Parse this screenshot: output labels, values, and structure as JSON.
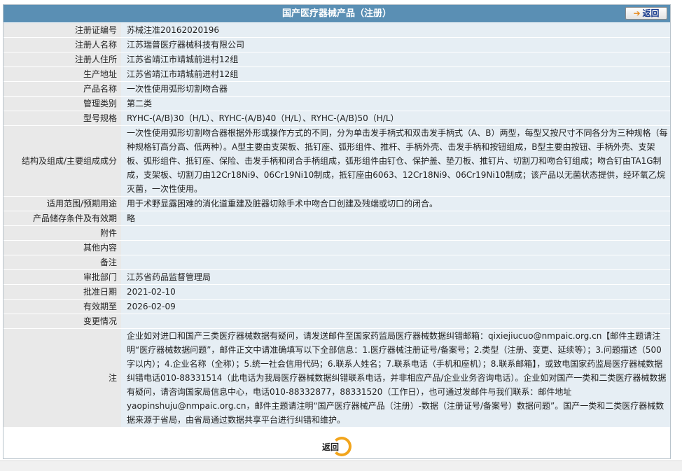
{
  "header": {
    "title": "国产医疗器械产品（注册）",
    "back_label": "返回",
    "back_icon": "arrow-right-icon"
  },
  "rows": [
    {
      "label": "注册证编号",
      "value": "苏械注准20162020196"
    },
    {
      "label": "注册人名称",
      "value": "江苏瑞普医疗器械科技有限公司"
    },
    {
      "label": "注册人住所",
      "value": "江苏省靖江市靖城前进村12组"
    },
    {
      "label": "生产地址",
      "value": "江苏省靖江市靖城前进村12组"
    },
    {
      "label": "产品名称",
      "value": "一次性使用弧形切割吻合器"
    },
    {
      "label": "管理类别",
      "value": "第二类"
    },
    {
      "label": "型号规格",
      "value": "RYHC-(A/B)30（H/L）、RYHC-(A/B)40（H/L）、RYHC-(A/B)50（H/L）"
    },
    {
      "label": "结构及组成/主要组成成分",
      "value": "一次性使用弧形切割吻合器根据外形或操作方式的不同，分为单击发手柄式和双击发手柄式（A、B）两型，每型又按尺寸不同各分为三种规格（每种规格钉高分高、低两种）。A型主要由支架板、抵钉座、弧形组件、推杆、手柄外壳、击发手柄和按钮组成，B型主要由按钮、手柄外壳、支架板、弧形组件、抵钉座、保险、击发手柄和闭合手柄组成，弧形组件由钉仓、保护盖、垫刀板、推钉片、切割刀和吻合钉组成；吻合钉由TA1G制成，支架板、切割刀由12Cr18Ni9、06Cr19Ni10制成，抵钉座由6063、12Cr18Ni9、06Cr19Ni10制成；该产品以无菌状态提供，经环氧乙烷灭菌，一次性使用。"
    },
    {
      "label": "适用范围/预期用途",
      "value": "用于术野显露困难的消化道重建及脏器切除手术中吻合口创建及残端或切口的闭合。"
    },
    {
      "label": "产品储存条件及有效期",
      "value": "略"
    },
    {
      "label": "附件",
      "value": ""
    },
    {
      "label": "其他内容",
      "value": ""
    },
    {
      "label": "备注",
      "value": ""
    },
    {
      "label": "审批部门",
      "value": "江苏省药品监督管理局"
    },
    {
      "label": "批准日期",
      "value": "2021-02-10"
    },
    {
      "label": "有效期至",
      "value": "2026-02-09"
    },
    {
      "label": "变更情况",
      "value": ""
    }
  ],
  "note": {
    "label": "注",
    "text": "企业如对进口和国产三类医疗器械数据有疑问，请发送邮件至国家药监局医疗器械数据纠错邮箱：qixiejiucuo@nmpaic.org.cn【邮件主题请注明“医疗器械数据问题”，邮件正文中请准确填写以下全部信息：1.医疗器械注册证号/备案号；2.类型（注册、变更、延续等）；3.问题描述（500字以内）；4.企业名称（全称）；5.统一社会信用代码；6.联系人姓名；7.联系电话（手机和座机）；8.联系邮箱】，或致电国家药监局医疗器械数据纠错电话010-88331514（此电话为我局医疗器械数据纠错联系电话，并非相应产品/企业业务咨询电话）。企业如对国产一类和二类医疗器械数据有疑问，请咨询国家局信息中心，电话010-88332877，88331520（工作日），也可通过发邮件与我们联系：邮件地址yaopinshuju@nmpaic.org.cn，邮件主题请注明“国产医疗器械产品（注册）-数据（注册证号/备案号）数据问题”。国产一类和二类医疗器械数据来源于省局，由省局通过数据共享平台进行纠错和维护。"
  },
  "footer": {
    "back_label": "返回",
    "back_icon": "circle-arrow-icon"
  },
  "colors": {
    "title_bar": "#5a8fb4",
    "label_bg": "#e9e9e9",
    "value_bg": "#e6eef4",
    "accent": "#f2a51c"
  }
}
